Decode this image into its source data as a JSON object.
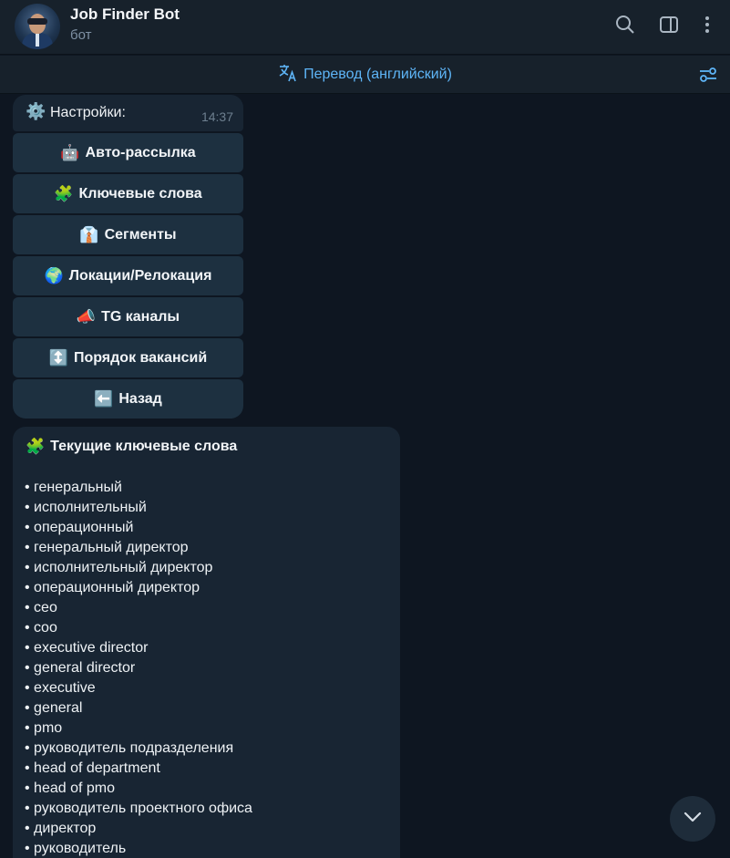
{
  "header": {
    "title": "Job Finder Bot",
    "subtitle": "бот",
    "icons": [
      "search-icon",
      "sidebar-panel-icon",
      "more-vertical-icon"
    ]
  },
  "translate_bar": {
    "icon": "translate-icon",
    "label": "Перевод (английский)",
    "settings_icon": "settings-sliders-icon"
  },
  "settings_message": {
    "icon": "⚙️",
    "text": "Настройки:",
    "time": "14:37"
  },
  "keyboard": [
    {
      "emoji": "🤖",
      "label": "Авто-рассылка"
    },
    {
      "emoji": "🧩",
      "label": "Ключевые слова"
    },
    {
      "emoji": "👔",
      "label": "Сегменты"
    },
    {
      "emoji": "🌍",
      "label": "Локации/Релокация"
    },
    {
      "emoji": "📣",
      "label": "TG каналы"
    },
    {
      "emoji": "↕️",
      "label": "Порядок вакансий"
    },
    {
      "emoji": "⬅️",
      "label": "Назад"
    }
  ],
  "keywords_message": {
    "emoji": "🧩",
    "title": "Текущие ключевые слова",
    "items": [
      "• генеральный",
      "• исполнительный",
      "• операционный",
      "• генеральный директор",
      "• исполнительный директор",
      "• операционный директор",
      "• ceo",
      "• coo",
      "• executive director",
      "• general director",
      "• executive",
      "• general",
      "• pmo",
      "• руководитель подразделения",
      "• head of department",
      "• head of pmo",
      "• руководитель проектного офиса",
      "• директор",
      "• руководитель"
    ]
  },
  "colors": {
    "background": "#0e1621",
    "header": "#17212b",
    "bubble": "#182533",
    "button": "#1d3040",
    "accent": "#5eb5f7"
  }
}
